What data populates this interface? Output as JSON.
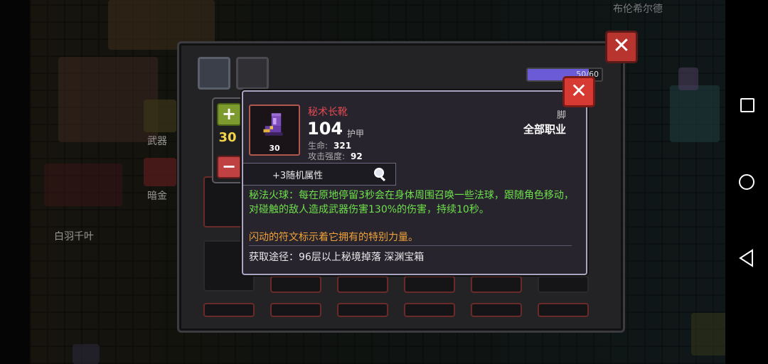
{
  "world": {
    "npc_name": "布伦希尔德",
    "npc_label_left": "白羽千叶",
    "sidebar_weapon": "武器",
    "sidebar_dark_gold": "暗金"
  },
  "inventory": {
    "capacity_text": "50/60",
    "capacity_fraction": 0.83
  },
  "stepper": {
    "value": "30",
    "plus": "+",
    "minus": "−"
  },
  "tooltip": {
    "item_name": "秘术长靴",
    "item_level": "30",
    "main_value": "104",
    "main_stat_type": "护甲",
    "stats": [
      {
        "label": "生命:",
        "value": "321"
      },
      {
        "label": "攻击强度:",
        "value": "92"
      }
    ],
    "slot": "脚",
    "class_restriction": "全部职业",
    "random_attributes": "+3随机属性",
    "description_effect": "秘法火球：每在原地停留3秒会在身体周围召唤一些法球，跟随角色移动，对碰触的敌人造成武器伤害130%的伤害，持续10秒。",
    "description_rune": "闪动的符文标示着它拥有的特别力量。",
    "source": "获取途径：96层以上秘境掉落 深渊宝箱"
  },
  "close_glyph": "✕",
  "colors": {
    "item_name": "#e24b52",
    "effect_text": "#6ee04a",
    "rune_text": "#f0a238",
    "tooltip_border": "#a9a4c0",
    "close_red": "#d63a33",
    "stepper_value": "#f2d44a"
  },
  "icons": [
    "boots-icon",
    "magnifier-icon",
    "close-icon",
    "plus-icon",
    "minus-icon",
    "back-icon",
    "home-icon",
    "recents-icon"
  ]
}
